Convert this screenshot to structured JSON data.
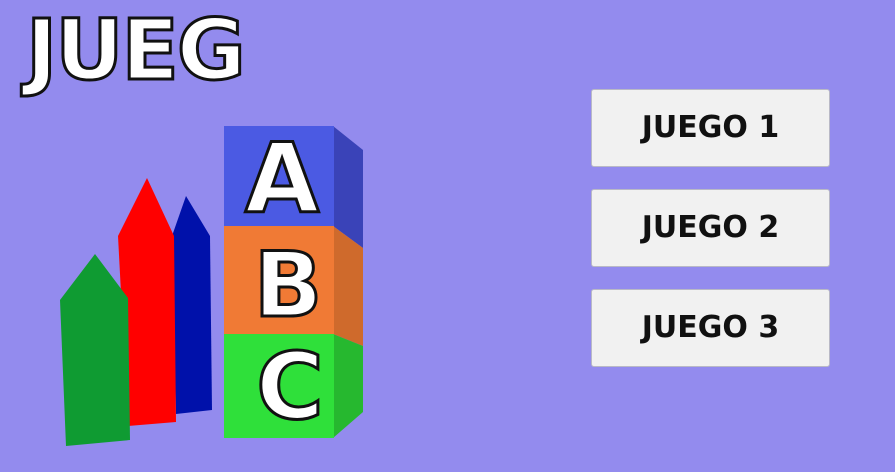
{
  "title": "JUEG",
  "blocks": {
    "letters": [
      "A",
      "B",
      "C"
    ]
  },
  "menu": {
    "buttons": [
      "JUEGO 1",
      "JUEGO 2",
      "JUEGO 3"
    ]
  },
  "colors": {
    "background": "#938bee",
    "crayon_green": "#0f9b32",
    "crayon_red": "#ff0000",
    "crayon_blue": "#0011aa",
    "block_blue": "#4b5ae3",
    "block_orange": "#f07a35",
    "block_green": "#2fe03a"
  }
}
